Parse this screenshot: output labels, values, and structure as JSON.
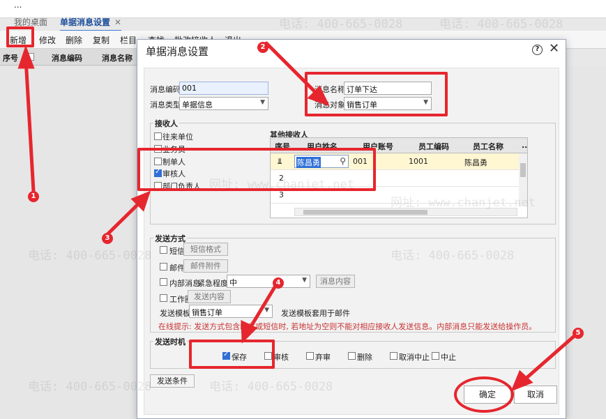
{
  "app": {
    "title": "...",
    "tabs": [
      {
        "label": "我的桌面"
      },
      {
        "label": "单据消息设置",
        "close": "✕"
      }
    ],
    "toolbar": [
      "新增",
      "修改",
      "删除",
      "复制",
      "栏目",
      "查找",
      "批改接收人",
      "退出"
    ],
    "grid_headers": [
      "序号",
      "消息编码",
      "消息名称"
    ]
  },
  "dialog": {
    "title": "单据消息设置",
    "help": "?",
    "close": "✕",
    "msg_code_label": "消息编码",
    "msg_code_value": "001",
    "msg_type_label": "消息类型",
    "msg_type_value": "单据信息",
    "msg_name_label": "消息名称",
    "msg_name_value": "订单下达",
    "msg_target_label": "消息对象",
    "msg_target_value": "销售订单",
    "receivers": {
      "title": "接收人",
      "items": [
        {
          "label": "往来单位",
          "checked": false
        },
        {
          "label": "业务员",
          "checked": false
        },
        {
          "label": "制单人",
          "checked": false
        },
        {
          "label": "审核人",
          "checked": true
        },
        {
          "label": "部门负责人",
          "checked": false
        }
      ]
    },
    "other_receivers": {
      "title": "其他接收人",
      "columns": [
        "序号",
        "用户姓名",
        "用户账号",
        "员工编码",
        "员工名称",
        "..."
      ],
      "rows": [
        {
          "seq": "1",
          "name": "陈昌勇",
          "account": "001",
          "emp_code": "1001",
          "emp_name": "陈昌勇"
        },
        {
          "seq": "2",
          "name": "",
          "account": "",
          "emp_code": "",
          "emp_name": ""
        },
        {
          "seq": "3",
          "name": "",
          "account": "",
          "emp_code": "",
          "emp_name": ""
        }
      ]
    },
    "send_methods": {
      "title": "发送方式",
      "sms_label": "短信",
      "sms_btn": "短信格式",
      "mail_label": "邮件",
      "mail_btn": "邮件附件",
      "internal_label": "内部消息",
      "urgency_label": "紧急程度",
      "urgency_value": "中",
      "internal_btn": "消息内容",
      "workcircle_label": "工作圈",
      "workcircle_btn": "发送内容",
      "template_label": "发送模板",
      "template_value": "销售订单",
      "template_note": "发送模板套用于邮件",
      "hint": "在线提示: 发送方式包含邮件或短信时, 若地址为空则不能对相应接收人发送信息。内部消息只能发送给操作员。"
    },
    "send_timing": {
      "title": "发送时机",
      "items": [
        {
          "label": "保存",
          "checked": true
        },
        {
          "label": "审核",
          "checked": false
        },
        {
          "label": "弃审",
          "checked": false
        },
        {
          "label": "删除",
          "checked": false
        },
        {
          "label": "取消中止",
          "checked": false
        },
        {
          "label": "中止",
          "checked": false
        }
      ]
    },
    "conditions_btn": "发送条件",
    "ok_btn": "确定",
    "cancel_btn": "取消"
  },
  "annotations": [
    "1",
    "2",
    "3",
    "4",
    "5"
  ],
  "watermark": {
    "phone": "电话: 400-665-0028",
    "site": "网址: www.chanjet.net"
  },
  "colors": {
    "annotation": "#e6262e",
    "accent": "#2f6fd6",
    "hint": "#c83232"
  }
}
